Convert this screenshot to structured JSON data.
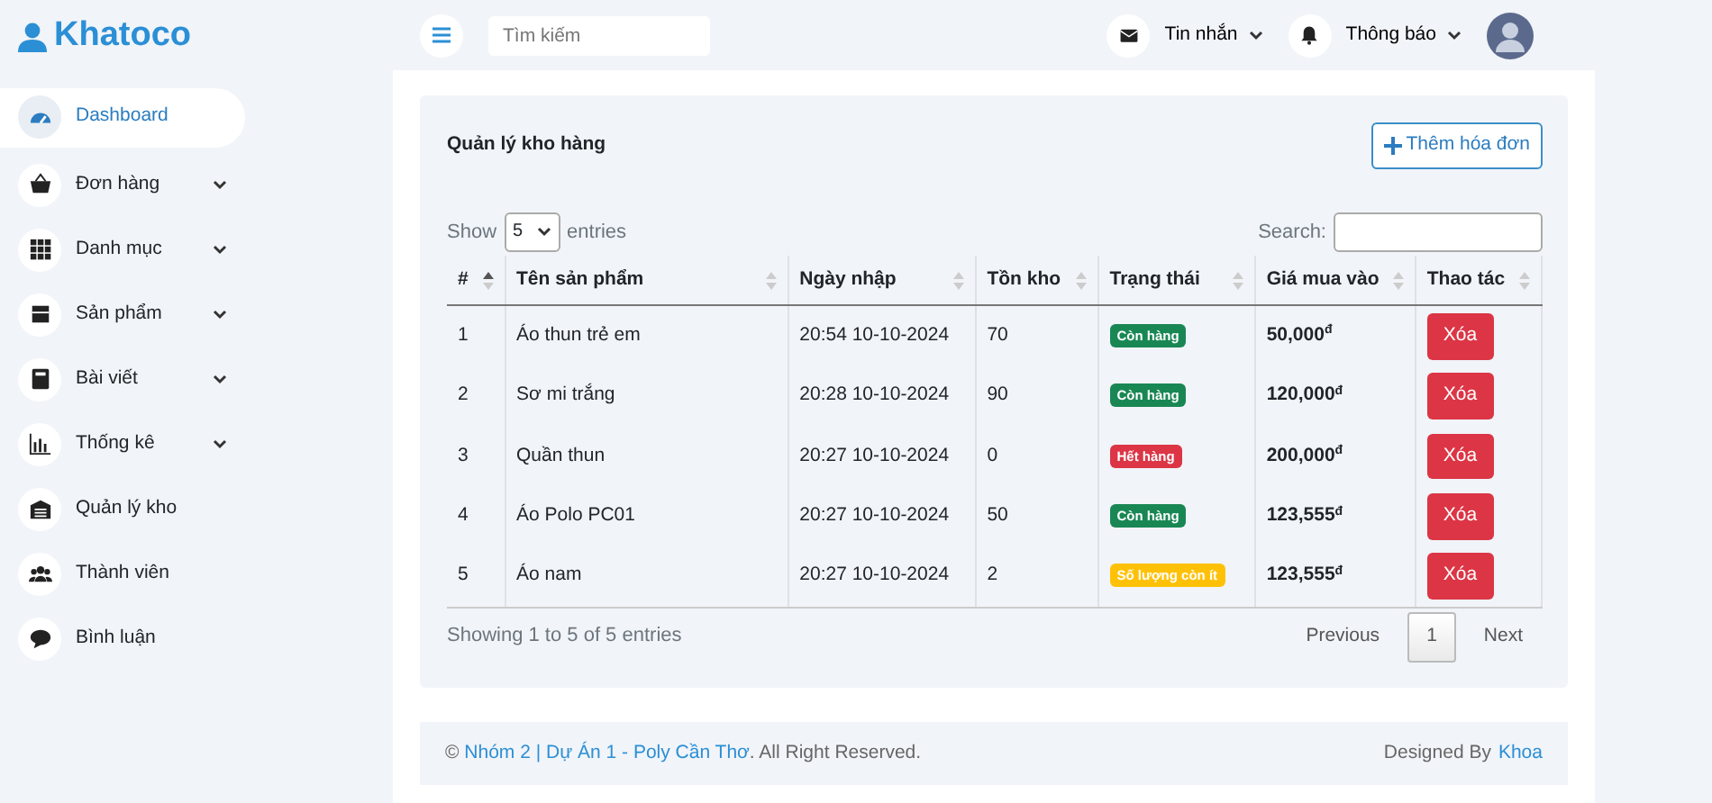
{
  "brand": "Khatoco",
  "sidebar": {
    "items": [
      {
        "label": "Dashboard",
        "selected": true,
        "dropdown": false
      },
      {
        "label": "Đơn hàng",
        "selected": false,
        "dropdown": true
      },
      {
        "label": "Danh mục",
        "selected": false,
        "dropdown": true
      },
      {
        "label": "Sản phẩm",
        "selected": false,
        "dropdown": true
      },
      {
        "label": "Bài viết",
        "selected": false,
        "dropdown": true
      },
      {
        "label": "Thống kê",
        "selected": false,
        "dropdown": true
      },
      {
        "label": "Quản lý kho",
        "selected": false,
        "dropdown": false
      },
      {
        "label": "Thành viên",
        "selected": false,
        "dropdown": false
      },
      {
        "label": "Bình luận",
        "selected": false,
        "dropdown": false
      }
    ]
  },
  "topbar": {
    "search": {
      "placeholder": "Tìm kiếm"
    },
    "menus": [
      {
        "label": "Tin nhắn"
      },
      {
        "label": "Thông báo"
      }
    ]
  },
  "card": {
    "title": "Quản lý kho hàng",
    "add_button": "Thêm hóa đơn",
    "length_menu": {
      "show": "Show",
      "value": "5",
      "entries": "entries"
    },
    "search_label": "Search:",
    "table": {
      "columns": [
        {
          "label": "#",
          "sorted": true
        },
        {
          "label": "Tên sản phẩm",
          "sorted": false
        },
        {
          "label": "Ngày nhập",
          "sorted": false
        },
        {
          "label": "Tồn kho",
          "sorted": false
        },
        {
          "label": "Trạng thái",
          "sorted": false
        },
        {
          "label": "Giá mua vào",
          "sorted": false
        },
        {
          "label": "Thao tác",
          "sorted": false
        }
      ],
      "rows": [
        {
          "index": "1",
          "name": "Áo thun trẻ em",
          "date": "20:54 10-10-2024",
          "stock": "70",
          "status": {
            "label": "Còn hàng",
            "kind": "in_stock"
          },
          "price": "50,000$^{đ}$",
          "action": "Xóa"
        },
        {
          "index": "2",
          "name": "Sơ mi trắng",
          "date": "20:28 10-10-2024",
          "stock": "90",
          "status": {
            "label": "Còn hàng",
            "kind": "in_stock"
          },
          "price": "120,000$^{đ}$",
          "action": "Xóa"
        },
        {
          "index": "3",
          "name": "Quần thun",
          "date": "20:27 10-10-2024",
          "stock": "0",
          "status": {
            "label": "Hết hàng",
            "kind": "out_of_stock"
          },
          "price": "200,000$^{đ}$",
          "action": "Xóa"
        },
        {
          "index": "4",
          "name": "Áo Polo PC01",
          "date": "20:27 10-10-2024",
          "stock": "50",
          "status": {
            "label": "Còn hàng",
            "kind": "in_stock"
          },
          "price": "123,555$^{đ}$",
          "action": "Xóa"
        },
        {
          "index": "5",
          "name": "Áo nam",
          "date": "20:27 10-10-2024",
          "stock": "2",
          "status": {
            "label": "Số lượng còn ít",
            "kind": "low"
          },
          "price": "123,555$^{đ}$",
          "action": "Xóa"
        }
      ]
    },
    "info": "Showing 1 to 5 of 5 entries",
    "pagination": [
      {
        "label": "Previous",
        "selected": false
      },
      {
        "label": "1",
        "selected": true
      },
      {
        "label": "Next",
        "selected": false
      }
    ]
  },
  "footer": {
    "copyright": "©",
    "link": "Nhóm 2 | Dự Án 1 - Poly Cần Thơ",
    "rest": ". All Right Reserved.",
    "designed_by": "Designed By",
    "author": "Khoa"
  }
}
